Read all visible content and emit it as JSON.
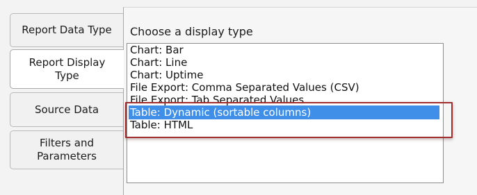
{
  "tabs": [
    {
      "label": "Report Data Type"
    },
    {
      "label": "Report Display Type"
    },
    {
      "label": "Source Data"
    },
    {
      "label": "Filters and Parameters"
    }
  ],
  "active_tab": "Report Display Type",
  "panel": {
    "label": "Choose a display type",
    "options": [
      {
        "label": "Chart: Bar"
      },
      {
        "label": "Chart: Line"
      },
      {
        "label": "Chart: Uptime"
      },
      {
        "label": "File Export: Comma Separated Values (CSV)"
      },
      {
        "label": "File Export: Tab Separated Values"
      },
      {
        "label": "Table: Dynamic (sortable columns)"
      },
      {
        "label": "Table: HTML"
      }
    ],
    "selected": "Table: Dynamic (sortable columns)"
  },
  "colors": {
    "selection": "#3f8fe8",
    "highlight_border": "#a02c2c"
  }
}
